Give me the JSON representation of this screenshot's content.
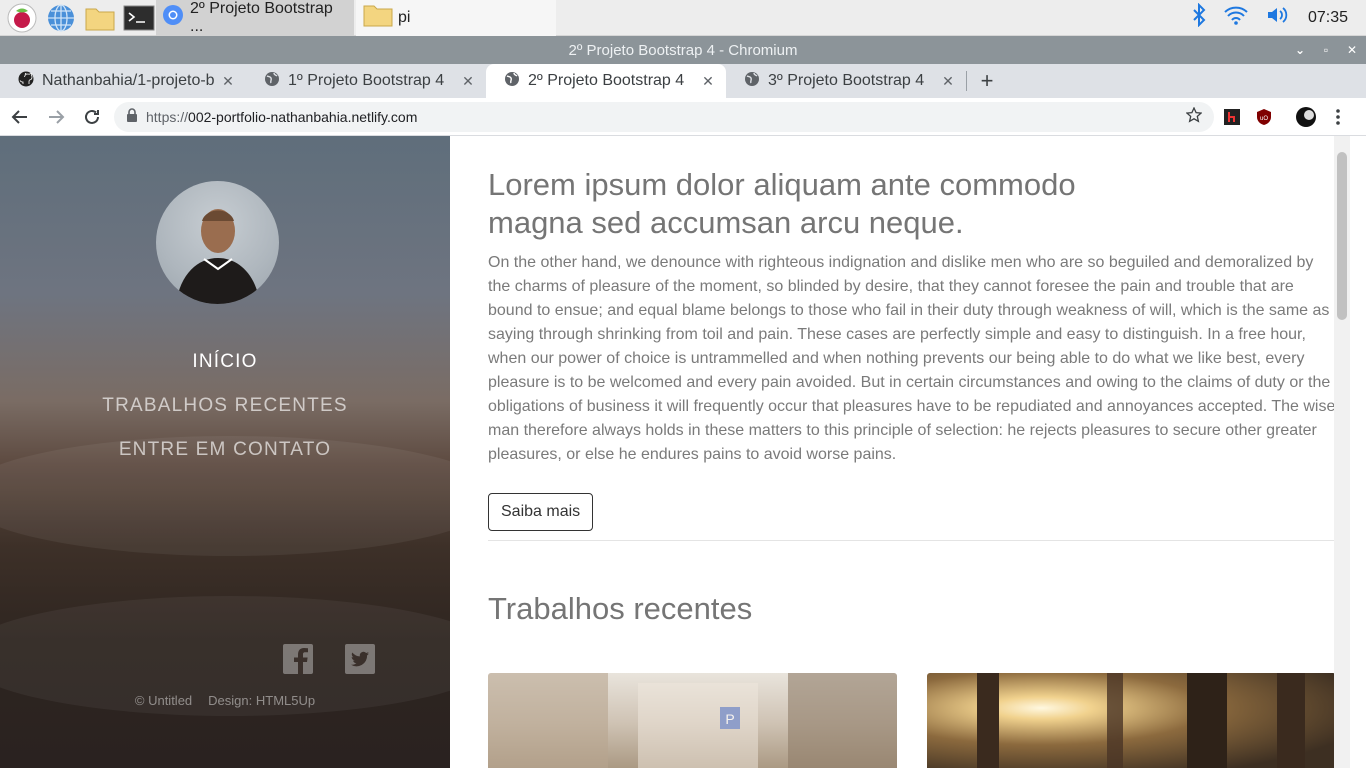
{
  "taskbar": {
    "tasks": [
      {
        "label": "2º Projeto Bootstrap ..."
      },
      {
        "label": "pi"
      }
    ],
    "clock": "07:35"
  },
  "window": {
    "title": "2º Projeto Bootstrap 4 - Chromium"
  },
  "tabs": [
    {
      "label": "Nathanbahia/1-projeto-b"
    },
    {
      "label": "1º Projeto Bootstrap 4"
    },
    {
      "label": "2º Projeto Bootstrap 4"
    },
    {
      "label": "3º Projeto Bootstrap 4"
    }
  ],
  "address": {
    "scheme": "https://",
    "host": "002-portfolio-nathanbahia.netlify.com"
  },
  "sidebar": {
    "nav": [
      {
        "label": "INÍCIO"
      },
      {
        "label": "TRABALHOS RECENTES"
      },
      {
        "label": "ENTRE EM CONTATO"
      }
    ],
    "credits": [
      "© Untitled",
      "Design: HTML5Up"
    ]
  },
  "main": {
    "heading": "Lorem ipsum dolor aliquam ante commodo magna sed accumsan arcu neque.",
    "paragraph": "On the other hand, we denounce with righteous indignation and dislike men who are so beguiled and demoralized by the charms of pleasure of the moment, so blinded by desire, that they cannot foresee the pain and trouble that are bound to ensue; and equal blame belongs to those who fail in their duty through weakness of will, which is the same as saying through shrinking from toil and pain. These cases are perfectly simple and easy to distinguish. In a free hour, when our power of choice is untrammelled and when nothing prevents our being able to do what we like best, every pleasure is to be welcomed and every pain avoided. But in certain circumstances and owing to the claims of duty or the obligations of business it will frequently occur that pleasures have to be repudiated and annoyances accepted. The wise man therefore always holds in these matters to this principle of selection: he rejects pleasures to secure other greater pleasures, or else he endures pains to avoid worse pains.",
    "button": "Saiba mais",
    "section_title": "Trabalhos recentes"
  },
  "colors": {
    "accent_blue": "#1a73e8",
    "sidebar_text": "#ffffff",
    "heading": "#757575"
  },
  "icons": [
    "raspberry-icon",
    "globe-icon",
    "folder-icon",
    "terminal-icon",
    "chromium-icon",
    "bluetooth-icon",
    "wifi-icon",
    "volume-icon",
    "github-icon",
    "web-icon",
    "back-icon",
    "forward-icon",
    "reload-icon",
    "lock-icon",
    "star-icon",
    "facebook-icon",
    "twitter-icon"
  ]
}
